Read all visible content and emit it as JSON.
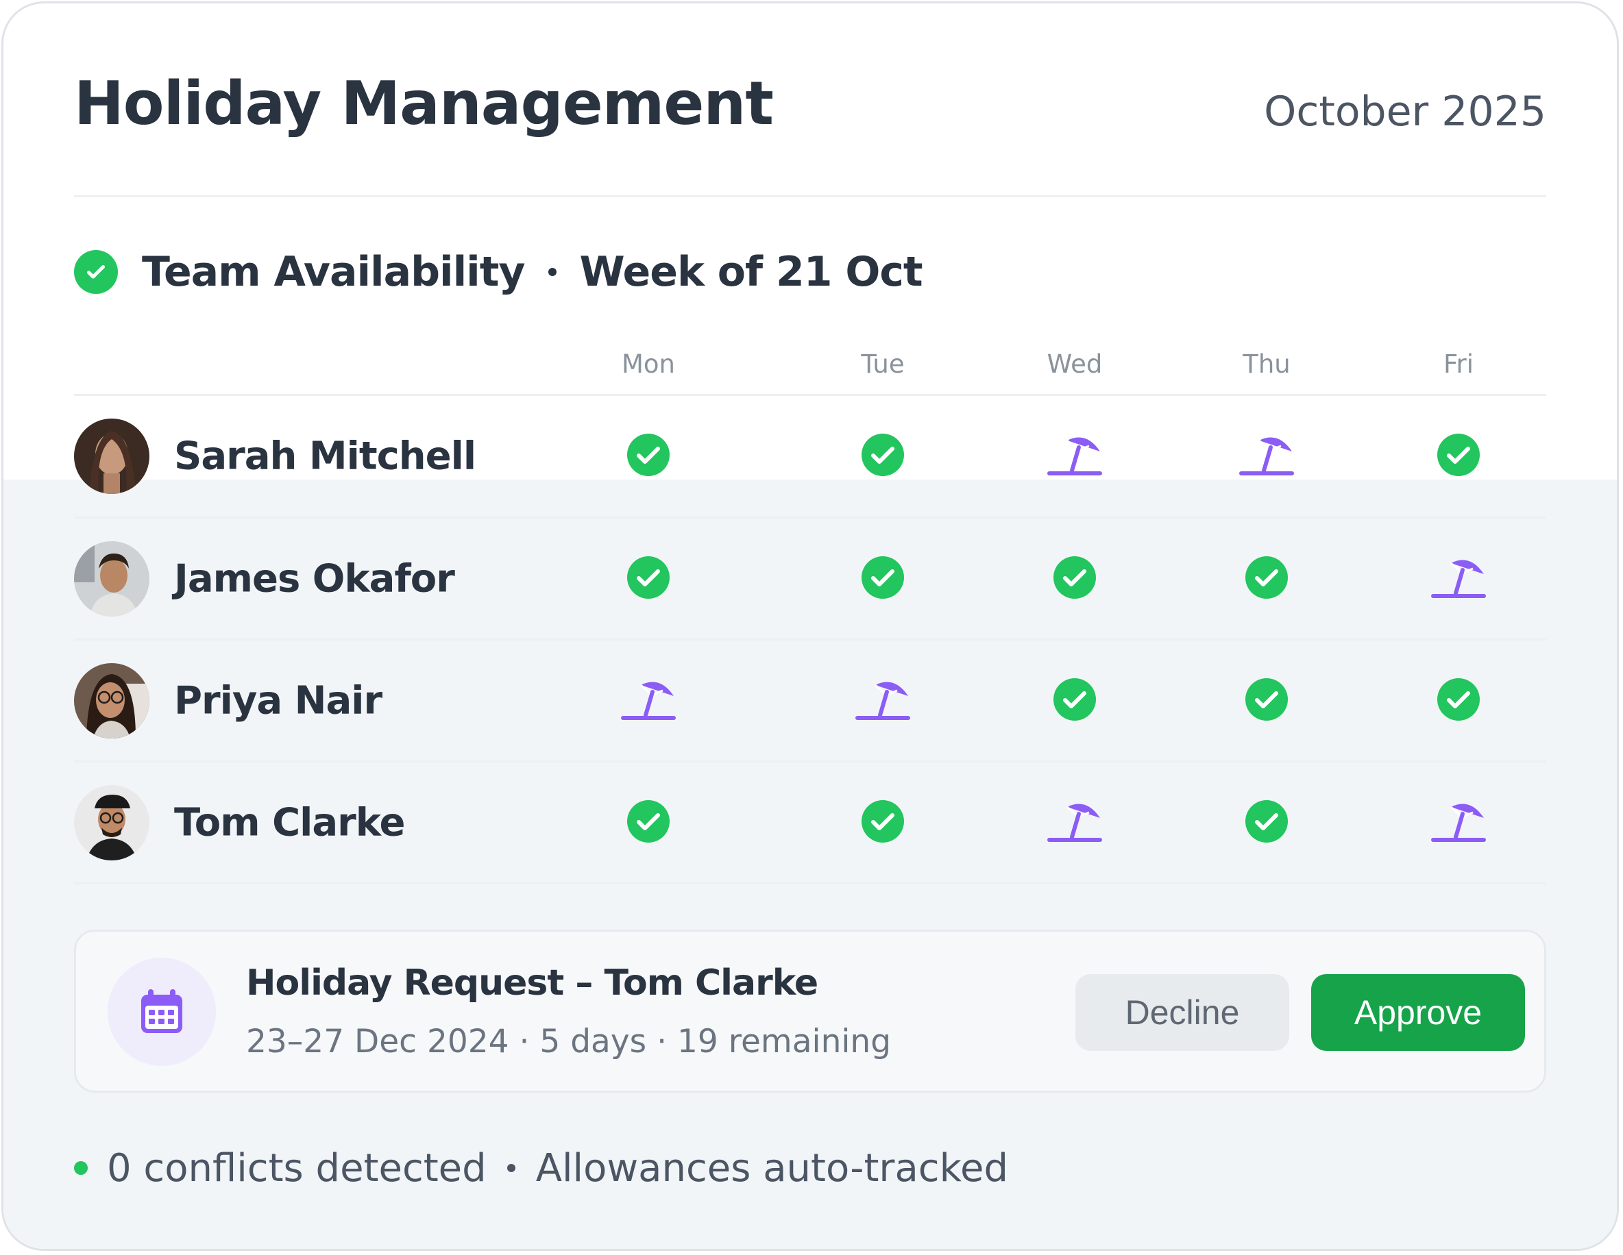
{
  "header": {
    "title": "Holiday Management",
    "month": "October 2025"
  },
  "section": {
    "title": "Team Availability",
    "week": "Week of 21 Oct"
  },
  "days": [
    "Mon",
    "Tue",
    "Wed",
    "Thu",
    "Fri"
  ],
  "people": [
    {
      "name": "Sarah Mitchell",
      "status": [
        "available",
        "available",
        "holiday",
        "holiday",
        "available"
      ]
    },
    {
      "name": "James Okafor",
      "status": [
        "available",
        "available",
        "available",
        "available",
        "holiday"
      ]
    },
    {
      "name": "Priya Nair",
      "status": [
        "holiday",
        "holiday",
        "available",
        "available",
        "available"
      ]
    },
    {
      "name": "Tom Clarke",
      "status": [
        "available",
        "available",
        "holiday",
        "available",
        "holiday"
      ]
    }
  ],
  "request": {
    "title": "Holiday Request – Tom Clarke",
    "subtitle": "23–27 Dec 2024 · 5 days · 19 remaining",
    "decline_label": "Decline",
    "approve_label": "Approve"
  },
  "footer": {
    "conflicts": "0 conflicts detected",
    "allowances": "Allowances auto-tracked"
  },
  "colors": {
    "available": "#22c55e",
    "holiday": "#8b5cf6",
    "approve": "#16a34a"
  }
}
